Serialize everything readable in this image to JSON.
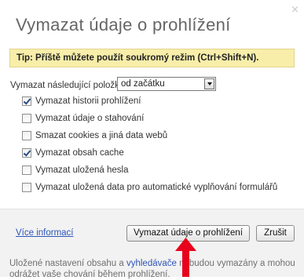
{
  "dialog": {
    "title": "Vymazat údaje o prohlížení",
    "close_glyph": "×",
    "tip": "Tip: Příště můžete použít soukromý režim (Ctrl+Shift+N).",
    "range_label": "Vymazat následující položky:",
    "range_selected": "od začátku",
    "options": [
      {
        "label": "Vymazat historii prohlížení",
        "checked": true
      },
      {
        "label": "Vymazat údaje o stahování",
        "checked": false
      },
      {
        "label": "Smazat cookies a jiná data webů",
        "checked": false
      },
      {
        "label": "Vymazat obsah cache",
        "checked": true
      },
      {
        "label": "Vymazat uložená hesla",
        "checked": false
      },
      {
        "label": "Vymazat uložená data pro automatické vyplňování formulářů",
        "checked": false
      }
    ],
    "more_info_link": "Více informací",
    "clear_button": "Vymazat údaje o prohlížení",
    "cancel_button": "Zrušit",
    "note_prefix": "Uložené nastavení obsahu a ",
    "note_link": "vyhledávače",
    "note_suffix": " nebudou vymazány a mohou odrážet vaše chování během prohlížení."
  },
  "colors": {
    "annotation_arrow": "#e8001c",
    "tip_background": "#f8eeaa",
    "link": "#2d56b8"
  }
}
